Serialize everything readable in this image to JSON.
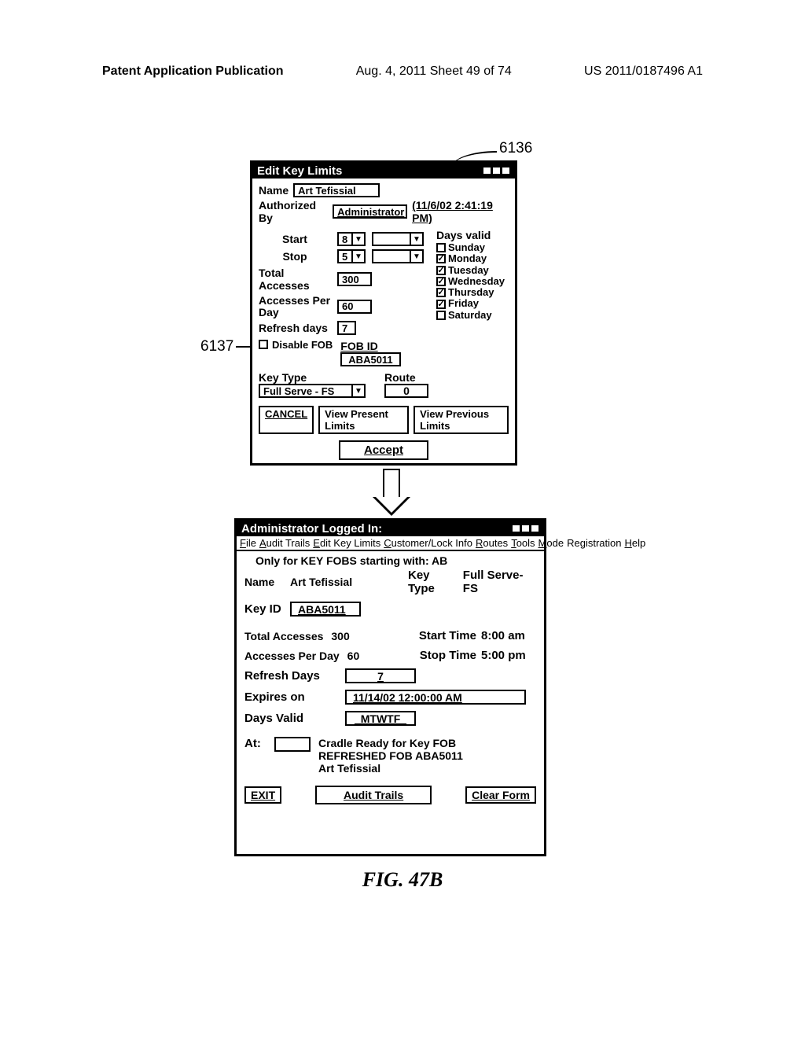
{
  "page_header": {
    "left": "Patent Application Publication",
    "mid": "Aug. 4, 2011  Sheet 49 of 74",
    "right": "US 2011/0187496 A1"
  },
  "callouts": {
    "c6136": "6136",
    "c6137": "6137"
  },
  "win1": {
    "title": "Edit Key Limits",
    "name_label": "Name",
    "name_value": "Art Tefissial",
    "auth_label": "Authorized By",
    "auth_value": "Administrator",
    "auth_time": "(11/6/02  2:41:19 PM)",
    "start_label": "Start",
    "start_hour": "8",
    "stop_label": "Stop",
    "stop_hour": "5",
    "total_label": "Total Accesses",
    "total_value": "300",
    "perday_label": "Accesses Per Day",
    "perday_value": "60",
    "refresh_label": "Refresh days",
    "refresh_value": "7",
    "disable_label": "Disable FOB",
    "fobid_label": "FOB ID",
    "fobid_value": "ABA5011",
    "keytype_label": "Key Type",
    "keytype_value": "Full Serve - FS",
    "route_label": "Route",
    "route_value": "0",
    "days_header": "Days valid",
    "days": [
      {
        "label": "Sunday",
        "checked": false
      },
      {
        "label": "Monday",
        "checked": true
      },
      {
        "label": "Tuesday",
        "checked": true
      },
      {
        "label": "Wednesday",
        "checked": true
      },
      {
        "label": "Thursday",
        "checked": true
      },
      {
        "label": "Friday",
        "checked": true
      },
      {
        "label": "Saturday",
        "checked": false
      }
    ],
    "btn_cancel": "CANCEL",
    "btn_present": "View Present Limits",
    "btn_previous": "View Previous Limits",
    "btn_accept": "Accept"
  },
  "win2": {
    "title": "Administrator Logged In:",
    "menu_file": "File",
    "menu_audit": "Audit Trails",
    "menu_edit": "Edit Key Limits",
    "menu_cust": "Customer/Lock Info",
    "menu_routes": "Routes",
    "menu_tools": "Tools",
    "menu_mode": "Mode",
    "menu_reg": "Registration",
    "menu_help": "Help",
    "note": "Only for KEY FOBS starting with: AB",
    "name_label": "Name",
    "name_value": "Art Tefissial",
    "keytype_label": "Key Type",
    "keytype_value": "Full Serve-FS",
    "keyid_label": "Key ID",
    "keyid_value": "ABA5011",
    "total_label": "Total Accesses",
    "total_value": "300",
    "start_label": "Start Time",
    "start_value": "8:00 am",
    "perday_label": "Accesses Per Day",
    "perday_value": "60",
    "stop_label": "Stop Time",
    "stop_value": "5:00 pm",
    "refresh_label": "Refresh Days",
    "refresh_value": "7",
    "expires_label": "Expires on",
    "expires_value": "11/14/02 12:00:00 AM",
    "daysvalid_label": "Days Valid",
    "daysvalid_value": "_MTWTF_",
    "at_label": "At:",
    "msg1": "Cradle Ready for Key FOB",
    "msg2": "REFRESHED FOB ABA5011",
    "msg3": "Art Tefissial",
    "btn_exit": "EXIT",
    "btn_audit": "Audit Trails",
    "btn_clear": "Clear Form"
  },
  "figure_caption": "FIG. 47B"
}
